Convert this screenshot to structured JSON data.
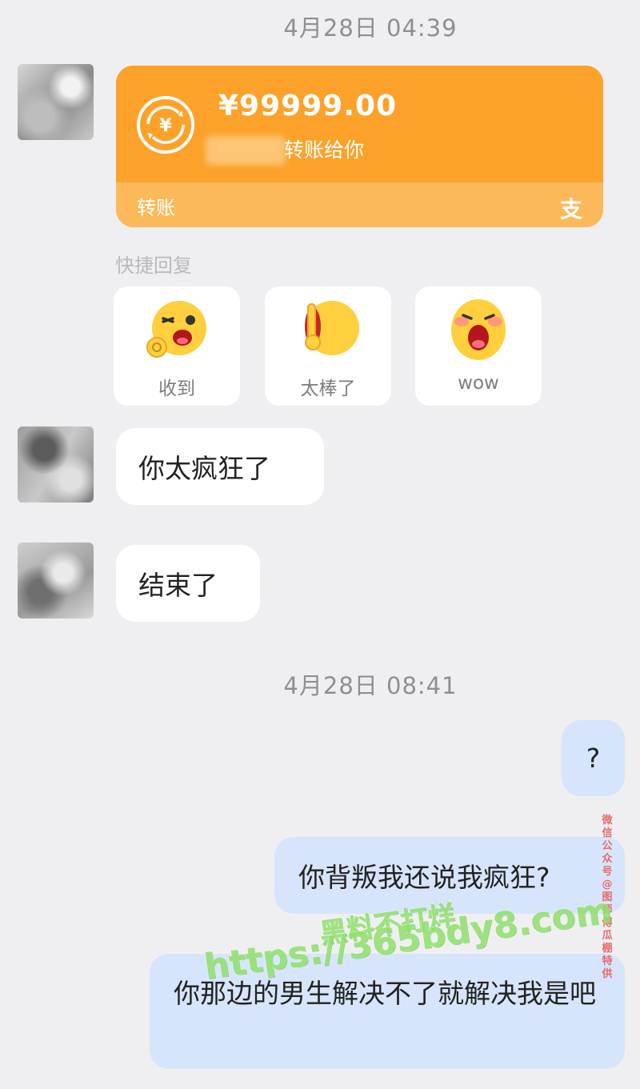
{
  "timestamps": [
    "4月28日 04:39",
    "4月28日 08:41"
  ],
  "transfer": {
    "amount": "¥99999.00",
    "description": "转账给你",
    "footer_label": "转账",
    "brand_icon": "alipay-icon",
    "brand_glyph": "支",
    "accent_color": "#fca22a"
  },
  "quick_reply": {
    "title": "快捷回复",
    "items": [
      {
        "label": "收到",
        "icon": "ok-wink-emoji-icon"
      },
      {
        "label": "太棒了",
        "icon": "thumbs-up-emoji-icon"
      },
      {
        "label": "wow",
        "icon": "shocked-emoji-icon"
      }
    ]
  },
  "messages": [
    {
      "side": "incoming",
      "text": "你太疯狂了"
    },
    {
      "side": "incoming",
      "text": "结束了"
    },
    {
      "side": "outgoing",
      "text": "?"
    },
    {
      "side": "outgoing",
      "text": "你背叛我还说我疯狂?"
    },
    {
      "side": "outgoing",
      "text": "你那边的男生解决不了就解决我是吧"
    }
  ],
  "watermarks": {
    "vertical": "微信公众号@图师傅瓜棚特供",
    "green_top": "黑料不打烊",
    "green_bottom": "https://365bdy8.com"
  }
}
